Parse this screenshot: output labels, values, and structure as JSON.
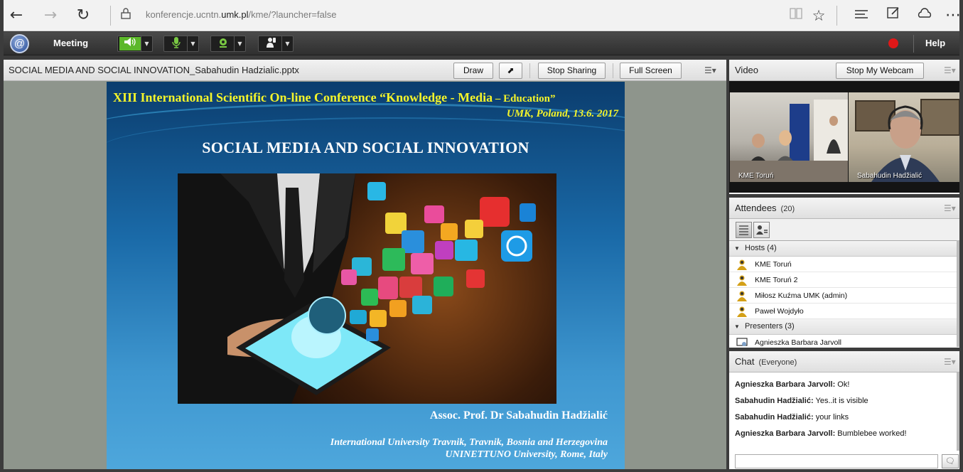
{
  "browser": {
    "url_host": "konferencje.ucntn.",
    "url_domain": "umk.pl",
    "url_path": "/kme/?launcher=false"
  },
  "meeting": {
    "menu_label": "Meeting",
    "help_label": "Help",
    "colors": {
      "bar": "#3a3a3a",
      "accent_green": "#6fd12a",
      "record": "#e01818"
    }
  },
  "share": {
    "file_title": "SOCIAL MEDIA AND SOCIAL INNOVATION_Sabahudin Hadzialic.pptx",
    "draw_label": "Draw",
    "stop_sharing_label": "Stop Sharing",
    "full_screen_label": "Full Screen"
  },
  "slide": {
    "conference_a": "XIII International Scientific On-line Conference “Knowledge - Media",
    "conference_b": " – Education”",
    "place": "UMK, Poland, 13.6. 2017",
    "title": "SOCIAL  MEDIA AND SOCIAL INNOVATION",
    "author": "Assoc. Prof. Dr Sabahudin Hadžialić",
    "affiliation_1": "International University Travnik,  Travnik, Bosnia and Herzegovina",
    "affiliation_2": "UNINETTUNO University, Rome, Italy"
  },
  "video": {
    "title": "Video",
    "stop_webcam_label": "Stop My Webcam",
    "feeds": [
      {
        "label": "KME Toruń"
      },
      {
        "label": "Sabahudin  Hadžialić"
      }
    ]
  },
  "attendees": {
    "title": "Attendees",
    "count": "(20)",
    "groups": [
      {
        "label": "Hosts (4)",
        "members": [
          "KME Toruń",
          "KME Toruń 2",
          "Miłosz Kuźma UMK (admin)",
          "Paweł Wojdyło"
        ]
      },
      {
        "label": "Presenters (3)",
        "members": [
          "Agnieszka Barbara Jarvoll"
        ]
      }
    ]
  },
  "chat": {
    "title": "Chat",
    "scope": "(Everyone)",
    "messages": [
      {
        "who": "Agnieszka Barbara Jarvoll:",
        "text": " Ok!"
      },
      {
        "who": "Sabahudin  Hadžialić:",
        "text": " Yes..it is visible"
      },
      {
        "who": "Sabahudin  Hadžialić:",
        "text": " your links"
      },
      {
        "who": "Agnieszka Barbara Jarvoll:",
        "text": " Bumblebee worked!"
      }
    ]
  }
}
